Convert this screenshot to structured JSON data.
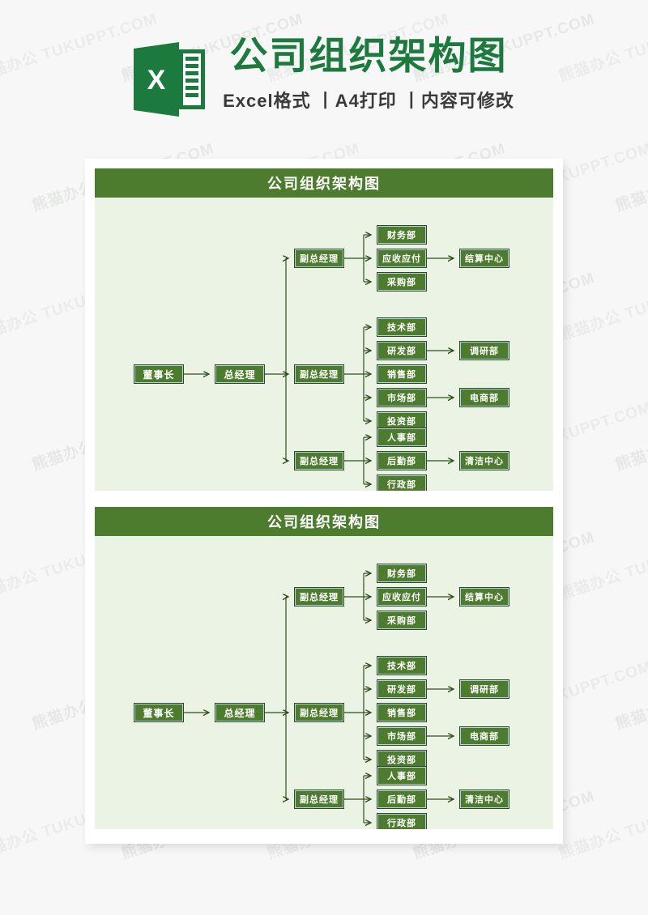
{
  "header": {
    "logo_letter": "X",
    "logo_name": "excel-logo",
    "main_title": "公司组织架构图",
    "sub_title": "Excel格式 丨A4打印 丨内容可修改",
    "brand_color": "#1d7a3e",
    "accent_color": "#4d7c2f"
  },
  "watermark": {
    "text": "熊猫办公 TUKUPPT.COM"
  },
  "blocks": [
    {
      "title": "公司组织架构图",
      "chart": {
        "root": "董事长",
        "level2": "总经理",
        "groups": [
          {
            "manager": "副总经理",
            "departments": [
              "财务部",
              "应收应付",
              "采购部"
            ],
            "subunits": [
              {
                "parent": "应收应付",
                "name": "结算中心"
              }
            ]
          },
          {
            "manager": "副总经理",
            "departments": [
              "技术部",
              "研发部",
              "销售部",
              "市场部",
              "投资部"
            ],
            "subunits": [
              {
                "parent": "研发部",
                "name": "调研部"
              },
              {
                "parent": "市场部",
                "name": "电商部"
              }
            ]
          },
          {
            "manager": "副总经理",
            "departments": [
              "人事部",
              "后勤部",
              "行政部"
            ],
            "subunits": [
              {
                "parent": "后勤部",
                "name": "清洁中心"
              }
            ]
          }
        ]
      }
    },
    {
      "title": "公司组织架构图",
      "chart": {
        "root": "董事长",
        "level2": "总经理",
        "groups": [
          {
            "manager": "副总经理",
            "departments": [
              "财务部",
              "应收应付",
              "采购部"
            ],
            "subunits": [
              {
                "parent": "应收应付",
                "name": "结算中心"
              }
            ]
          },
          {
            "manager": "副总经理",
            "departments": [
              "技术部",
              "研发部",
              "销售部",
              "市场部",
              "投资部"
            ],
            "subunits": [
              {
                "parent": "研发部",
                "name": "调研部"
              },
              {
                "parent": "市场部",
                "name": "电商部"
              }
            ]
          },
          {
            "manager": "副总经理",
            "departments": [
              "人事部",
              "后勤部",
              "行政部"
            ],
            "subunits": [
              {
                "parent": "后勤部",
                "name": "清洁中心"
              }
            ]
          }
        ]
      }
    }
  ]
}
